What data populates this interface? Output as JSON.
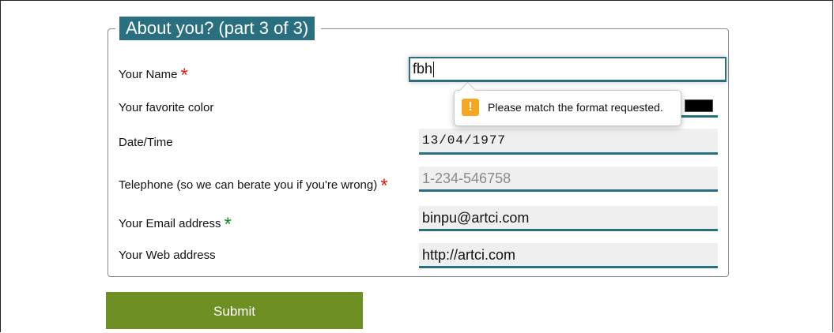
{
  "form": {
    "legend": "About you? (part 3 of 3)",
    "fields": {
      "name": {
        "label": "Your Name",
        "required": "*",
        "value": "fbh"
      },
      "color": {
        "label": "Your favorite color",
        "value": "#000000"
      },
      "datetime": {
        "label": "Date/Time",
        "value": "13/04/1977"
      },
      "telephone": {
        "label": "Telephone (so we can berate you if you're wrong)",
        "required": "*",
        "placeholder": "1-234-546758"
      },
      "email": {
        "label": "Your Email address",
        "required": "*",
        "value": "binpu@artci.com"
      },
      "web": {
        "label": "Your Web address",
        "value": "http://artci.com"
      }
    },
    "validation": {
      "icon": "warning-icon",
      "icon_glyph": "!",
      "message": "Please match the format requested.",
      "color": "#f5a623"
    },
    "submit_label": "Submit"
  },
  "colors": {
    "accent": "#2a6f80",
    "submit": "#6e8f23",
    "required_red": "#e41b17",
    "required_green": "#1a8a1a"
  }
}
